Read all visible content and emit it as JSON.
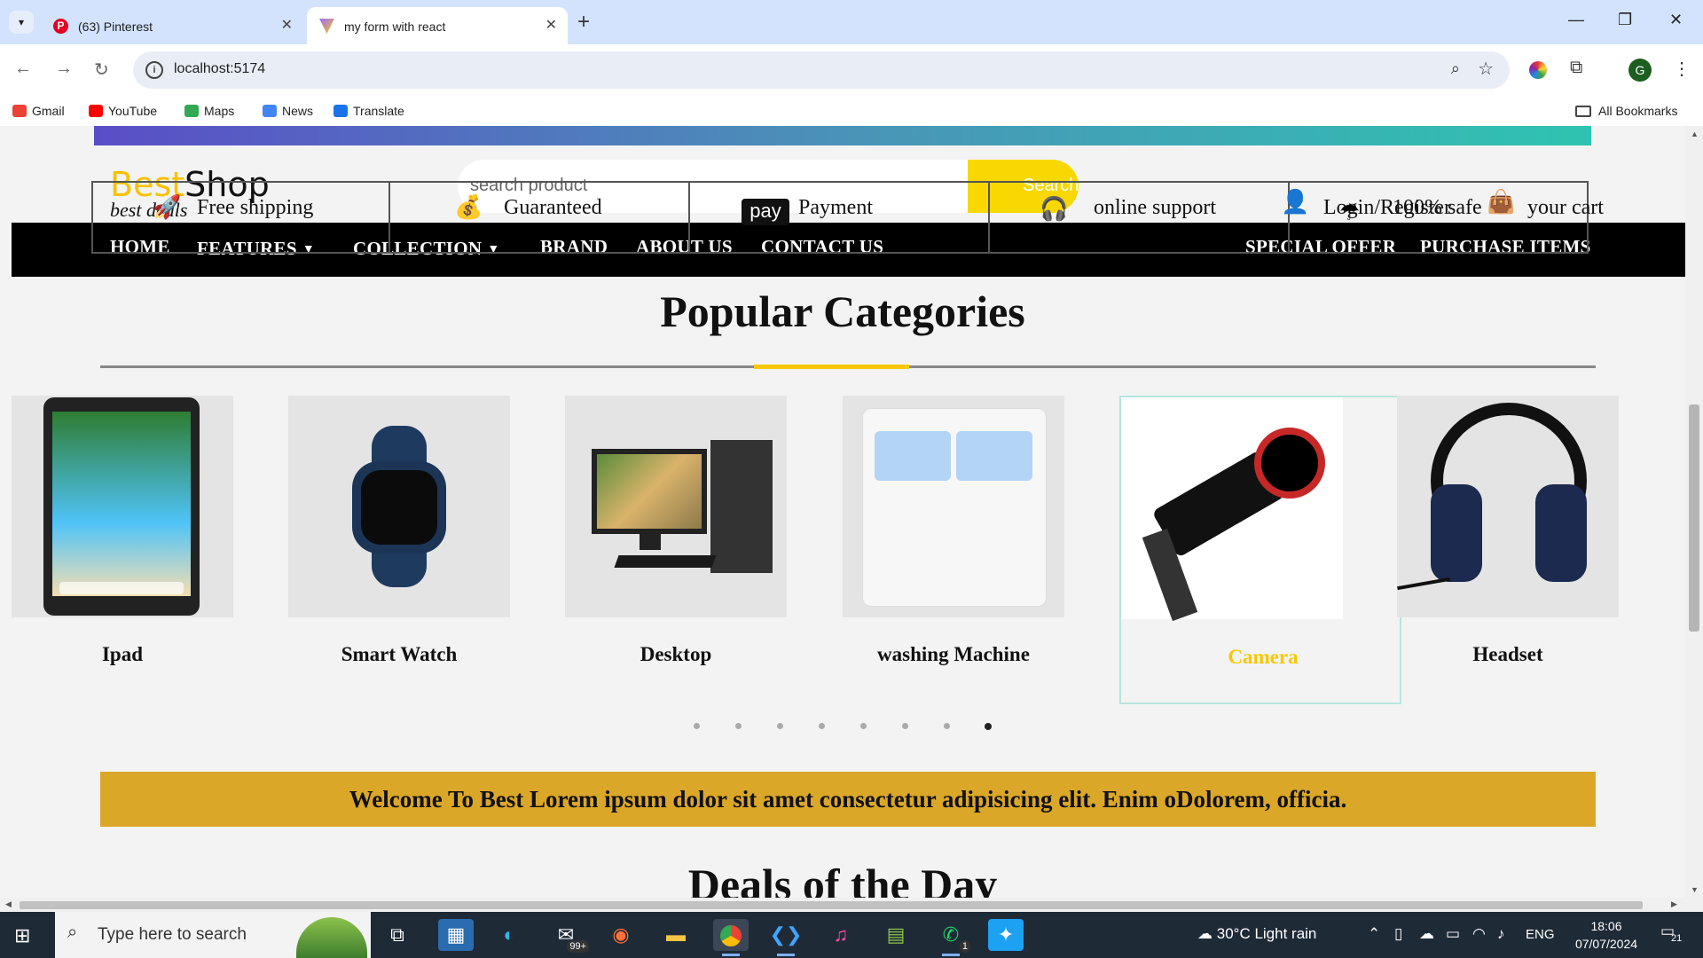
{
  "browser": {
    "tabs": [
      {
        "title": "(63) Pinterest",
        "favicon": "P"
      },
      {
        "title": "my form with react"
      }
    ],
    "url": "localhost:5174",
    "profile_initial": "G",
    "bookmarks": [
      "Gmail",
      "YouTube",
      "Maps",
      "News",
      "Translate"
    ],
    "all_bookmarks": "All Bookmarks"
  },
  "site": {
    "logo_best": "Best",
    "logo_shop": "Shop",
    "logo_tagline": "best deals",
    "search_placeholder": "search product",
    "search_button": "Search",
    "features": [
      "Free shipping",
      "Guaranteed",
      "Payment",
      "online support",
      "100% safe"
    ],
    "pay_badge": "pay",
    "account": {
      "login": "Login/Register",
      "cart": "your cart"
    },
    "nav": {
      "home": "HOME",
      "features": "FEATURES",
      "collection": "COLLECTION",
      "brand": "BRAND",
      "about": "ABOUT US",
      "contact": "CONTACT US",
      "special": "SPECIAL OFFER",
      "purchase": "PURCHASE ITEMS"
    },
    "categories_title": "Popular Categories",
    "categories": [
      "Ipad",
      "Smart Watch",
      "Desktop",
      "washing Machine",
      "Camera",
      "Headset"
    ],
    "highlighted_category": "Camera",
    "welcome": "Welcome To Best Lorem ipsum dolor sit amet consectetur adipisicing elit. Enim oDolorem, officia.",
    "deals_title": "Deals of the Day",
    "carousel": {
      "dots": 8,
      "active": 8
    }
  },
  "taskbar": {
    "search_placeholder": "Type here to search",
    "mail_badge": "99+",
    "whatsapp_badge": "1",
    "weather": "30°C  Light rain",
    "language": "ENG",
    "time": "18:06",
    "date": "07/07/2024",
    "notifications": "21"
  },
  "colors": {
    "accent": "#f8c800",
    "navbar": "#000000",
    "banner": "#dba728",
    "tab_strip": "#d3e3fd"
  }
}
